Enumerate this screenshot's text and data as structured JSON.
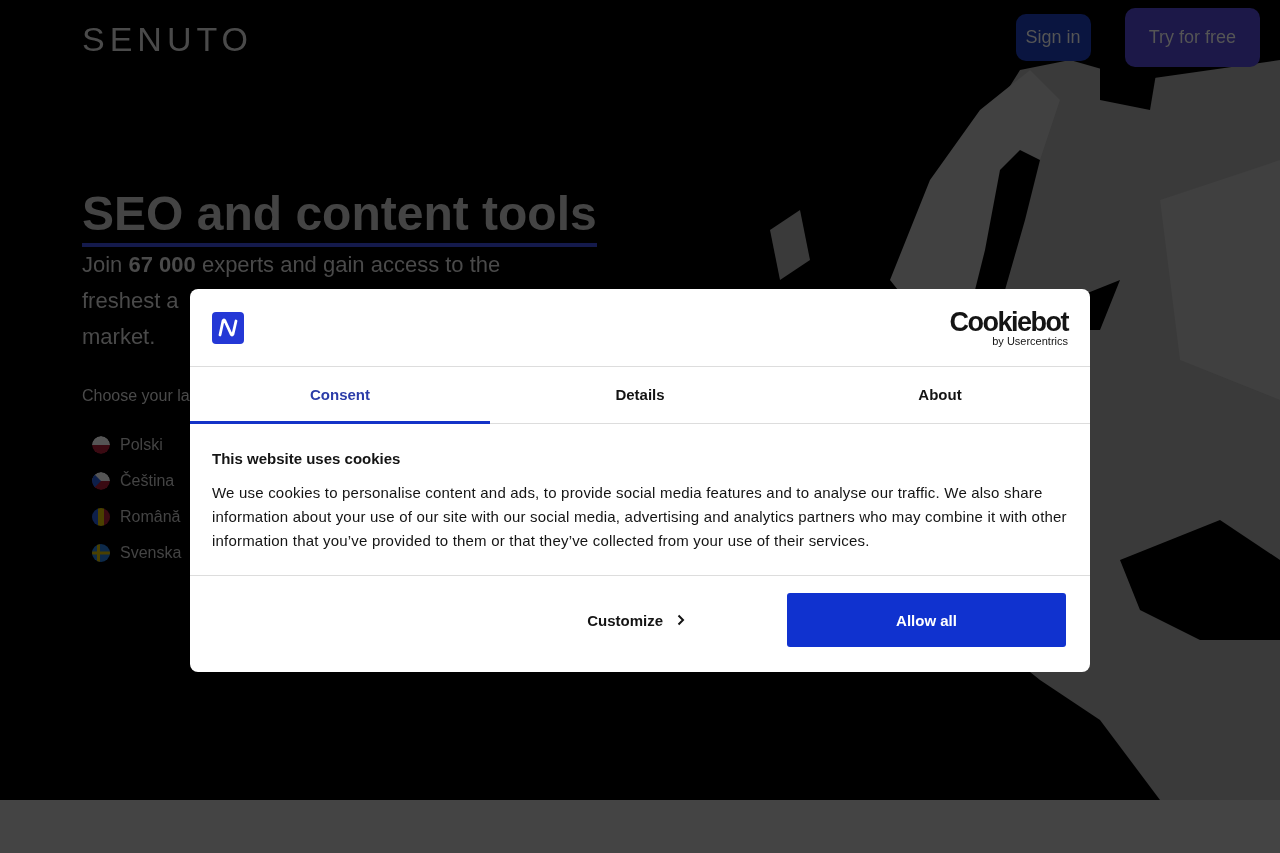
{
  "header": {
    "logo": "SENUTO",
    "buttons": [
      {
        "label": "Sign in",
        "kind": "secondary"
      },
      {
        "label": "Try for free",
        "kind": "primary"
      }
    ]
  },
  "hero": {
    "title": "SEO and content tools",
    "intro_lines": [
      "Join **67 000** experts and gain access to the",
      "freshest a",
      "market."
    ],
    "language_prompt": "Choose your la",
    "languages": [
      {
        "label": "Polski",
        "kind": "pl"
      },
      {
        "label": "Čeština",
        "kind": "cz"
      },
      {
        "label": "Română",
        "kind": "ro"
      },
      {
        "label": "Svenska",
        "kind": "se"
      }
    ],
    "map": {
      "kind": "picture"
    }
  },
  "cookie_dialog": {
    "brand": "Cookiebot",
    "brand_sub": "by Usercentrics",
    "tabs": [
      {
        "label": "Consent",
        "selected": true
      },
      {
        "label": "Details",
        "selected": false
      },
      {
        "label": "About",
        "selected": false
      }
    ],
    "heading": "This website uses cookies",
    "body": "We use cookies to personalise content and ads, to provide social media features and to analyse our traffic. We also share information about your use of our site with our social media, advertising and analytics partners who may combine it with other information that you’ve provided to them or that they’ve collected from your use of their services.",
    "buttons": [
      {
        "label": "Customize",
        "kind": "link"
      },
      {
        "label": "Allow all",
        "kind": "primary"
      }
    ]
  }
}
